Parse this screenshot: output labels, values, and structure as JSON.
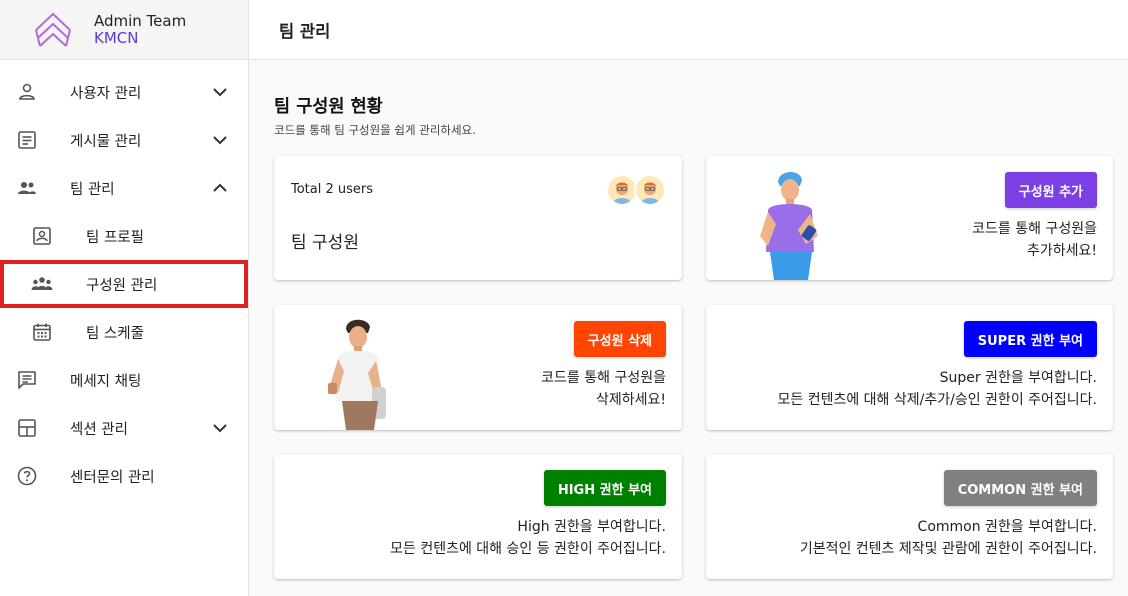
{
  "brand": {
    "title": "Admin Team",
    "subtitle": "KMCN"
  },
  "header": {
    "title": "팀 관리"
  },
  "sidebar": {
    "items": [
      {
        "label": "사용자 관리"
      },
      {
        "label": "게시물 관리"
      },
      {
        "label": "팀 관리"
      },
      {
        "label": "팀 프로필"
      },
      {
        "label": "구성원 관리"
      },
      {
        "label": "팀 스케줄"
      },
      {
        "label": "메세지 채팅"
      },
      {
        "label": "섹션 관리"
      },
      {
        "label": "센터문의 관리"
      }
    ]
  },
  "main": {
    "title": "팀 구성원 현황",
    "description": "코드를 통해 팀 구성원을 쉽게 관리하세요.",
    "members_card": {
      "total": "Total 2 users",
      "title": "팀 구성원"
    },
    "add_card": {
      "button": "구성원 추가",
      "line1": "코드를 통해 구성원을",
      "line2": "추가하세요!"
    },
    "delete_card": {
      "button": "구성원 삭제",
      "line1": "코드를 통해 구성원을",
      "line2": "삭제하세요!"
    },
    "super_card": {
      "button": "SUPER 권한 부여",
      "line1": "Super 권한을 부여합니다.",
      "line2": "모든 컨텐츠에 대해 삭제/추가/승인 권한이 주어집니다."
    },
    "high_card": {
      "button": "HIGH 권한 부여",
      "line1": "High 권한을 부여합니다.",
      "line2": "모든 컨텐츠에 대해 승인 등 권한이 주어집니다."
    },
    "common_card": {
      "button": "COMMON 권한 부여",
      "line1": "Common 권한을 부여합니다.",
      "line2": "기본적인 컨텐츠 제작및 관람에 권한이 주어집니다."
    }
  },
  "colors": {
    "brand": "#5b3ad8",
    "add": "#7b3fe4",
    "delete": "#ff4500",
    "super": "#0000ff",
    "high": "#008000",
    "common": "#808080",
    "selected_outline": "#e02020"
  }
}
